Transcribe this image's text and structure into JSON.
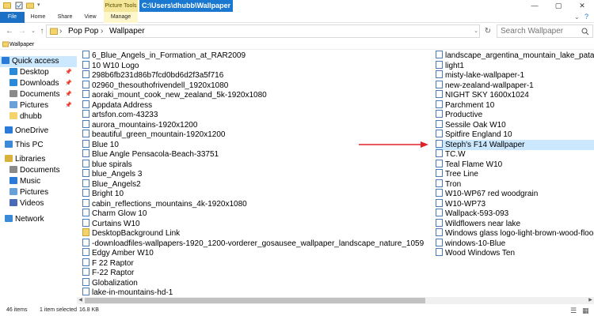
{
  "window": {
    "title_path": "C:\\Users\\dhubb\\Wallpaper",
    "context_tab": "Picture Tools",
    "minimize": "—",
    "maximize": "▢",
    "close": "✕"
  },
  "ribbon": {
    "tabs": [
      "File",
      "Home",
      "Share",
      "View",
      "Manage"
    ]
  },
  "address": {
    "crumbs": [
      "Pop Pop",
      "Wallpaper"
    ],
    "separators": [
      "›",
      "›"
    ],
    "search_placeholder": "Search Wallpaper"
  },
  "quickbar": {
    "label": "Wallpaper"
  },
  "navpane": {
    "items": [
      {
        "label": "Quick access",
        "icon": "star-icon",
        "color": "#2a7ad8",
        "pinned": false,
        "selected": true
      },
      {
        "label": "Desktop",
        "icon": "desktop-icon",
        "color": "#2a8ad8",
        "pinned": true
      },
      {
        "label": "Downloads",
        "icon": "downloads-icon",
        "color": "#2a8ad8",
        "pinned": true
      },
      {
        "label": "Documents",
        "icon": "documents-icon",
        "color": "#8a8a8a",
        "pinned": true
      },
      {
        "label": "Pictures",
        "icon": "pictures-icon",
        "color": "#6aa0d8",
        "pinned": true
      },
      {
        "label": "dhubb",
        "icon": "folder-icon",
        "color": "#f4d36b",
        "pinned": false
      },
      {
        "label": "OneDrive",
        "icon": "onedrive-icon",
        "color": "#2a7ad8",
        "pinned": false
      },
      {
        "label": "This PC",
        "icon": "pc-icon",
        "color": "#3a8ad8",
        "pinned": false
      },
      {
        "label": "Libraries",
        "icon": "libraries-icon",
        "color": "#d8b23a",
        "pinned": false
      },
      {
        "label": "Documents",
        "icon": "documents-icon",
        "color": "#8a8a8a",
        "pinned": false
      },
      {
        "label": "Music",
        "icon": "music-icon",
        "color": "#2a7ad8",
        "pinned": false
      },
      {
        "label": "Pictures",
        "icon": "pictures-icon",
        "color": "#6aa0d8",
        "pinned": false
      },
      {
        "label": "Videos",
        "icon": "videos-icon",
        "color": "#4a6ab8",
        "pinned": false
      },
      {
        "label": "Network",
        "icon": "network-icon",
        "color": "#3a8ad8",
        "pinned": false
      }
    ],
    "pin_glyph": "📌"
  },
  "files": {
    "column1": [
      {
        "name": "6_Blue_Angels_in_Formation_at_RAR2009",
        "type": "image"
      },
      {
        "name": "10 W10 Logo",
        "type": "image"
      },
      {
        "name": "298b6fb231d86b7fcd0bd6d2f3a5f716",
        "type": "image"
      },
      {
        "name": "02960_thesouthofrivendell_1920x1080",
        "type": "image"
      },
      {
        "name": "aoraki_mount_cook_new_zealand_5k-1920x1080",
        "type": "image"
      },
      {
        "name": "Appdata Address",
        "type": "image"
      },
      {
        "name": "artsfon.com-43233",
        "type": "image"
      },
      {
        "name": "aurora_mountains-1920x1200",
        "type": "image"
      },
      {
        "name": "beautiful_green_mountain-1920x1200",
        "type": "image"
      },
      {
        "name": "Blue 10",
        "type": "image"
      },
      {
        "name": "Blue Angle Pensacola-Beach-33751",
        "type": "image"
      },
      {
        "name": "blue spirals",
        "type": "image"
      },
      {
        "name": "blue_Angels 3",
        "type": "image"
      },
      {
        "name": "Blue_Angels2",
        "type": "image"
      },
      {
        "name": "Bright 10",
        "type": "image"
      },
      {
        "name": "cabin_reflections_mountains_4k-1920x1080",
        "type": "image"
      },
      {
        "name": "Charm Glow 10",
        "type": "image"
      },
      {
        "name": "Curtains W10",
        "type": "image"
      },
      {
        "name": "DesktopBackground Link",
        "type": "folder"
      },
      {
        "name": "-downloadfiles-wallpapers-1920_1200-vorderer_gosausee_wallpaper_landscape_nature_1059",
        "type": "image"
      },
      {
        "name": "Edgy Amber W10",
        "type": "image"
      },
      {
        "name": "F 22 Raptor",
        "type": "image"
      },
      {
        "name": "F-22 Raptor",
        "type": "image"
      },
      {
        "name": "Globalization",
        "type": "image"
      },
      {
        "name": "lake-in-mountains-hd-1",
        "type": "image"
      }
    ],
    "column2": [
      {
        "name": "landscape_argentina_mountain_lake_patago",
        "type": "image"
      },
      {
        "name": "light1",
        "type": "image"
      },
      {
        "name": "misty-lake-wallpaper-1",
        "type": "image"
      },
      {
        "name": "new-zealand-wallpaper-1",
        "type": "image"
      },
      {
        "name": "NIGHT SKY 1600x1024",
        "type": "image"
      },
      {
        "name": "Parchment 10",
        "type": "image"
      },
      {
        "name": "Productive",
        "type": "image"
      },
      {
        "name": "Sessile Oak W10",
        "type": "image"
      },
      {
        "name": "Spitfire England 10",
        "type": "image"
      },
      {
        "name": "Steph's F14 Wallpaper",
        "type": "image",
        "selected": true
      },
      {
        "name": "TC.W",
        "type": "image"
      },
      {
        "name": "Teal Flame W10",
        "type": "image"
      },
      {
        "name": "Tree Line",
        "type": "image"
      },
      {
        "name": "Tron",
        "type": "image"
      },
      {
        "name": "W10-WP67 red woodgrain",
        "type": "image"
      },
      {
        "name": "W10-WP73",
        "type": "image"
      },
      {
        "name": "Wallpack-593-093",
        "type": "image"
      },
      {
        "name": "Wildflowers near lake",
        "type": "image"
      },
      {
        "name": "Windows glass logo-light-brown-wood-floor",
        "type": "image"
      },
      {
        "name": "windows-10-Blue",
        "type": "image"
      },
      {
        "name": "Wood Windows Ten",
        "type": "image"
      }
    ]
  },
  "status": {
    "item_count": "46 items",
    "selection": "1 item selected",
    "size": "16.8 KB"
  },
  "colors": {
    "accent": "#1b78d0",
    "selection": "#cce8ff",
    "annotation": "#e0232a"
  }
}
